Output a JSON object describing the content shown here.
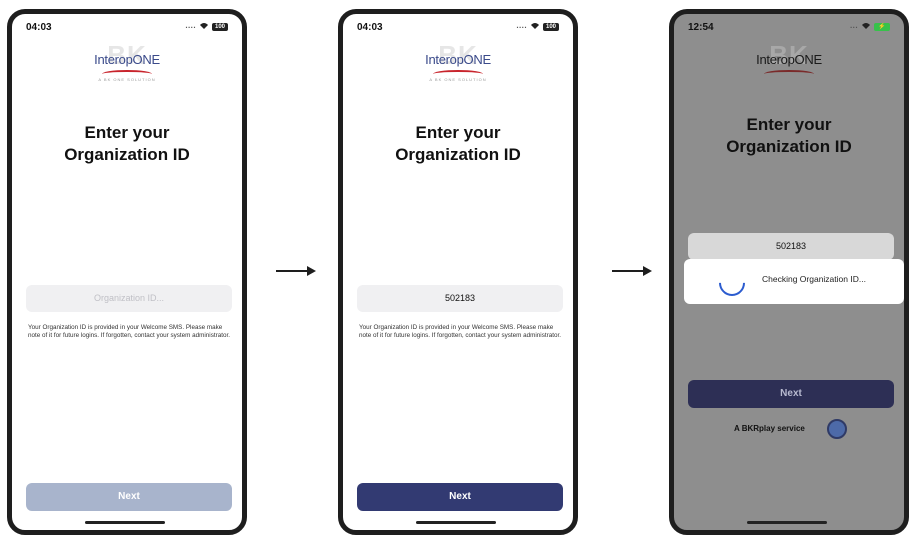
{
  "screens": [
    {
      "time": "04:03",
      "battery": "100",
      "logo": {
        "bk": "BK",
        "name": "InteropONE",
        "tag": "A BK ONE SOLUTION"
      },
      "title_line1": "Enter your",
      "title_line2": "Organization ID",
      "input": {
        "value": "",
        "placeholder": "Organization ID..."
      },
      "help_text": "Your Organization ID is provided in your Welcome SMS. Please make note of it for future logins. If forgotten, contact your system administrator.",
      "next_label": "Next"
    },
    {
      "time": "04:03",
      "battery": "100",
      "logo": {
        "bk": "BK",
        "name": "InteropONE",
        "tag": "A BK ONE SOLUTION"
      },
      "title_line1": "Enter your",
      "title_line2": "Organization ID",
      "input": {
        "value": "502183",
        "placeholder": "Organization ID..."
      },
      "help_text": "Your Organization ID is provided in your Welcome SMS. Please make note of it for future logins. If forgotten, contact your system administrator.",
      "next_label": "Next"
    },
    {
      "time": "12:54",
      "logo": {
        "bk": "BK",
        "name": "InteropONE"
      },
      "title_line1": "Enter your",
      "title_line2": "Organization ID",
      "input": {
        "value": "502183"
      },
      "dialog_message": "Checking Organization ID...",
      "next_label": "Next",
      "service_text": "A BKRplay service"
    }
  ],
  "colors": {
    "next_disabled": "#a8b4cc",
    "next_enabled": "#323a72",
    "spinner": "#2c5ccf",
    "logo_red": "#c8242c"
  }
}
